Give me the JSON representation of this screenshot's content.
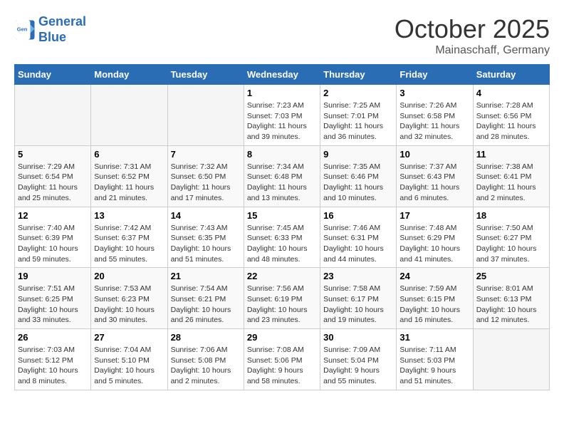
{
  "header": {
    "logo": {
      "line1": "General",
      "line2": "Blue"
    },
    "month": "October 2025",
    "location": "Mainaschaff, Germany"
  },
  "weekdays": [
    "Sunday",
    "Monday",
    "Tuesday",
    "Wednesday",
    "Thursday",
    "Friday",
    "Saturday"
  ],
  "weeks": [
    [
      {
        "day": "",
        "empty": true
      },
      {
        "day": "",
        "empty": true
      },
      {
        "day": "",
        "empty": true
      },
      {
        "day": "1",
        "sunrise": "7:23 AM",
        "sunset": "7:03 PM",
        "daylight": "11 hours and 39 minutes."
      },
      {
        "day": "2",
        "sunrise": "7:25 AM",
        "sunset": "7:01 PM",
        "daylight": "11 hours and 36 minutes."
      },
      {
        "day": "3",
        "sunrise": "7:26 AM",
        "sunset": "6:58 PM",
        "daylight": "11 hours and 32 minutes."
      },
      {
        "day": "4",
        "sunrise": "7:28 AM",
        "sunset": "6:56 PM",
        "daylight": "11 hours and 28 minutes."
      }
    ],
    [
      {
        "day": "5",
        "sunrise": "7:29 AM",
        "sunset": "6:54 PM",
        "daylight": "11 hours and 25 minutes."
      },
      {
        "day": "6",
        "sunrise": "7:31 AM",
        "sunset": "6:52 PM",
        "daylight": "11 hours and 21 minutes."
      },
      {
        "day": "7",
        "sunrise": "7:32 AM",
        "sunset": "6:50 PM",
        "daylight": "11 hours and 17 minutes."
      },
      {
        "day": "8",
        "sunrise": "7:34 AM",
        "sunset": "6:48 PM",
        "daylight": "11 hours and 13 minutes."
      },
      {
        "day": "9",
        "sunrise": "7:35 AM",
        "sunset": "6:46 PM",
        "daylight": "11 hours and 10 minutes."
      },
      {
        "day": "10",
        "sunrise": "7:37 AM",
        "sunset": "6:43 PM",
        "daylight": "11 hours and 6 minutes."
      },
      {
        "day": "11",
        "sunrise": "7:38 AM",
        "sunset": "6:41 PM",
        "daylight": "11 hours and 2 minutes."
      }
    ],
    [
      {
        "day": "12",
        "sunrise": "7:40 AM",
        "sunset": "6:39 PM",
        "daylight": "10 hours and 59 minutes."
      },
      {
        "day": "13",
        "sunrise": "7:42 AM",
        "sunset": "6:37 PM",
        "daylight": "10 hours and 55 minutes."
      },
      {
        "day": "14",
        "sunrise": "7:43 AM",
        "sunset": "6:35 PM",
        "daylight": "10 hours and 51 minutes."
      },
      {
        "day": "15",
        "sunrise": "7:45 AM",
        "sunset": "6:33 PM",
        "daylight": "10 hours and 48 minutes."
      },
      {
        "day": "16",
        "sunrise": "7:46 AM",
        "sunset": "6:31 PM",
        "daylight": "10 hours and 44 minutes."
      },
      {
        "day": "17",
        "sunrise": "7:48 AM",
        "sunset": "6:29 PM",
        "daylight": "10 hours and 41 minutes."
      },
      {
        "day": "18",
        "sunrise": "7:50 AM",
        "sunset": "6:27 PM",
        "daylight": "10 hours and 37 minutes."
      }
    ],
    [
      {
        "day": "19",
        "sunrise": "7:51 AM",
        "sunset": "6:25 PM",
        "daylight": "10 hours and 33 minutes."
      },
      {
        "day": "20",
        "sunrise": "7:53 AM",
        "sunset": "6:23 PM",
        "daylight": "10 hours and 30 minutes."
      },
      {
        "day": "21",
        "sunrise": "7:54 AM",
        "sunset": "6:21 PM",
        "daylight": "10 hours and 26 minutes."
      },
      {
        "day": "22",
        "sunrise": "7:56 AM",
        "sunset": "6:19 PM",
        "daylight": "10 hours and 23 minutes."
      },
      {
        "day": "23",
        "sunrise": "7:58 AM",
        "sunset": "6:17 PM",
        "daylight": "10 hours and 19 minutes."
      },
      {
        "day": "24",
        "sunrise": "7:59 AM",
        "sunset": "6:15 PM",
        "daylight": "10 hours and 16 minutes."
      },
      {
        "day": "25",
        "sunrise": "8:01 AM",
        "sunset": "6:13 PM",
        "daylight": "10 hours and 12 minutes."
      }
    ],
    [
      {
        "day": "26",
        "sunrise": "7:03 AM",
        "sunset": "5:12 PM",
        "daylight": "10 hours and 8 minutes."
      },
      {
        "day": "27",
        "sunrise": "7:04 AM",
        "sunset": "5:10 PM",
        "daylight": "10 hours and 5 minutes."
      },
      {
        "day": "28",
        "sunrise": "7:06 AM",
        "sunset": "5:08 PM",
        "daylight": "10 hours and 2 minutes."
      },
      {
        "day": "29",
        "sunrise": "7:08 AM",
        "sunset": "5:06 PM",
        "daylight": "9 hours and 58 minutes."
      },
      {
        "day": "30",
        "sunrise": "7:09 AM",
        "sunset": "5:04 PM",
        "daylight": "9 hours and 55 minutes."
      },
      {
        "day": "31",
        "sunrise": "7:11 AM",
        "sunset": "5:03 PM",
        "daylight": "9 hours and 51 minutes."
      },
      {
        "day": "",
        "empty": true
      }
    ]
  ]
}
